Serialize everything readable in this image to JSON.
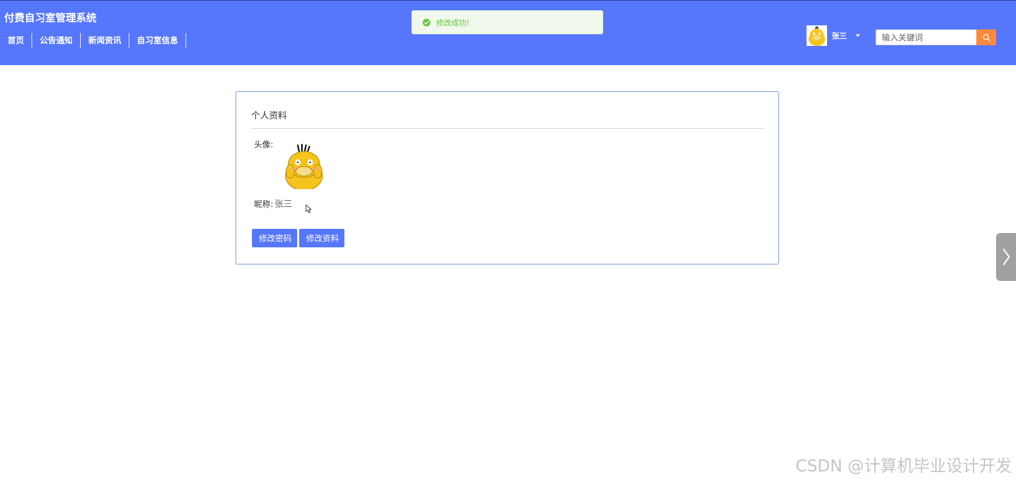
{
  "header": {
    "site_title": "付费自习室管理系统",
    "nav": [
      "首页",
      "公告通知",
      "新闻资讯",
      "自习室信息"
    ],
    "user": {
      "name": "张三"
    },
    "search": {
      "placeholder": "输入关键词",
      "value": ""
    },
    "colors": {
      "header_bg": "#5677fc",
      "search_button": "#ff8a3d"
    }
  },
  "toast": {
    "message": "修改成功!",
    "type": "success",
    "icon": "check-circle-icon"
  },
  "profile": {
    "title": "个人资料",
    "avatar_label": "头像:",
    "nickname_label": "昵称:",
    "nickname": "张三",
    "buttons": {
      "change_password": "修改密码",
      "edit_profile": "修改资料"
    }
  },
  "side_toggle": {
    "icon": "chevron-right-icon"
  },
  "watermark": "CSDN @计算机毕业设计开发"
}
